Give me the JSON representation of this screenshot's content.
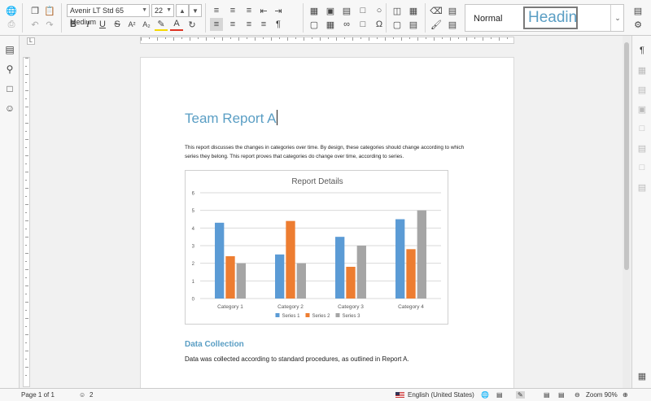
{
  "toolbar": {
    "font_name": "Avenir LT Std 65 Medium",
    "font_size": "22",
    "bold_label": "B",
    "italic_label": "I",
    "underline_label": "U",
    "strike_label": "S",
    "superscript_label": "A²",
    "subscript_label": "A₂",
    "font_color_label": "A",
    "styles": {
      "normal_label": "Normal",
      "heading_label": "Headin"
    }
  },
  "document": {
    "title": "Team Report A",
    "intro": "This report discusses the changes in categories over time. By design, these categories should change according to which series they belong. This report proves that categories do change over time, according to series.",
    "section_heading": "Data Collection",
    "section_body": "Data was collected according to standard procedures, as outlined in Report A."
  },
  "chart_data": {
    "type": "bar",
    "title": "Report Details",
    "categories": [
      "Category 1",
      "Category 2",
      "Category 3",
      "Category 4"
    ],
    "series": [
      {
        "name": "Series 1",
        "color": "#5b9bd5",
        "values": [
          4.3,
          2.5,
          3.5,
          4.5
        ]
      },
      {
        "name": "Series 2",
        "color": "#ed7d31",
        "values": [
          2.4,
          4.4,
          1.8,
          2.8
        ]
      },
      {
        "name": "Series 3",
        "color": "#a5a5a5",
        "values": [
          2.0,
          2.0,
          3.0,
          5.0
        ]
      }
    ],
    "ylim": [
      0,
      6
    ],
    "yticks": [
      0,
      1,
      2,
      3,
      4,
      5,
      6
    ],
    "grid": true,
    "legend": "bottom"
  },
  "status": {
    "page_info": "Page 1 of 1",
    "users_count": "2",
    "language": "English (United States)",
    "zoom_label": "Zoom 90%"
  }
}
